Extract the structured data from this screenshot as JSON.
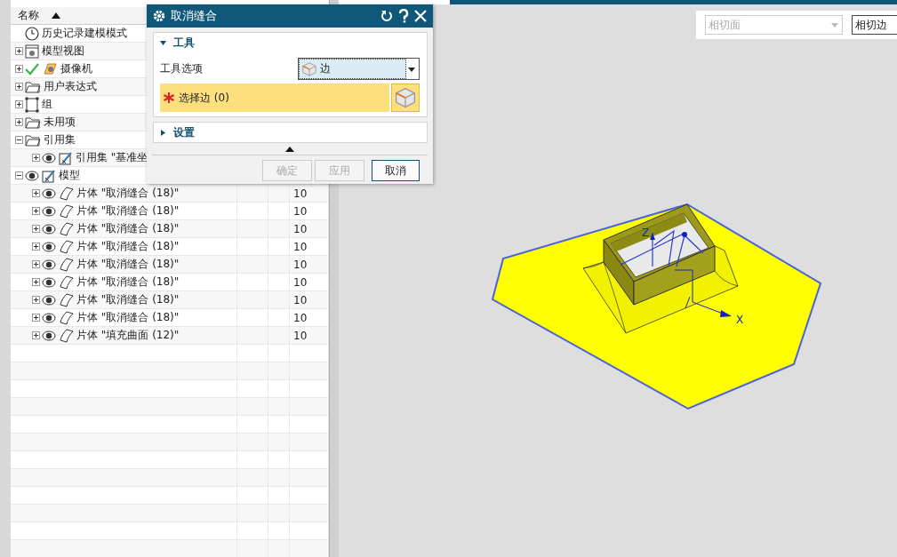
{
  "navigator": {
    "header": "名称",
    "items": [
      {
        "label": "历史记录建模模式",
        "kind": "clock"
      },
      {
        "label": "模型视图",
        "kind": "view",
        "expanded": false
      },
      {
        "label": "摄像机",
        "kind": "camera",
        "expanded": false,
        "checked": true
      },
      {
        "label": "用户表达式",
        "kind": "folder",
        "expanded": false
      },
      {
        "label": "组",
        "kind": "group",
        "expanded": false
      },
      {
        "label": "未用项",
        "kind": "folder",
        "expanded": false
      },
      {
        "label": "引用集",
        "kind": "folder",
        "expanded": true,
        "children": [
          {
            "label": "引用集 \"基准坐",
            "kind": "refset",
            "expanded": false,
            "visible": true
          }
        ]
      },
      {
        "label": "模型",
        "kind": "refset",
        "expanded": true,
        "visible": true,
        "children": [
          {
            "label": "片体 \"取消缝合 (18)\"",
            "kind": "sheet",
            "expanded": false,
            "visible": true,
            "value": "10"
          },
          {
            "label": "片体 \"取消缝合 (18)\"",
            "kind": "sheet",
            "expanded": false,
            "visible": true,
            "value": "10"
          },
          {
            "label": "片体 \"取消缝合 (18)\"",
            "kind": "sheet",
            "expanded": false,
            "visible": true,
            "value": "10"
          },
          {
            "label": "片体 \"取消缝合 (18)\"",
            "kind": "sheet",
            "expanded": false,
            "visible": true,
            "value": "10"
          },
          {
            "label": "片体 \"取消缝合 (18)\"",
            "kind": "sheet",
            "expanded": false,
            "visible": true,
            "value": "10"
          },
          {
            "label": "片体 \"取消缝合 (18)\"",
            "kind": "sheet",
            "expanded": false,
            "visible": true,
            "value": "10"
          },
          {
            "label": "片体 \"取消缝合 (18)\"",
            "kind": "sheet",
            "expanded": false,
            "visible": true,
            "value": "10"
          },
          {
            "label": "片体 \"取消缝合 (18)\"",
            "kind": "sheet",
            "expanded": false,
            "visible": true,
            "value": "10"
          },
          {
            "label": "片体 \"填充曲面 (12)\"",
            "kind": "sheet",
            "expanded": false,
            "visible": true,
            "value": "10"
          }
        ]
      }
    ]
  },
  "dialog": {
    "title": "取消缝合",
    "sections": [
      {
        "title": "工具",
        "expanded": true,
        "option_label": "工具选项",
        "option_value": "边",
        "select": {
          "label": "选择边 (0)",
          "selected": true
        }
      },
      {
        "title": "设置",
        "expanded": false
      }
    ],
    "buttons": [
      {
        "label": "确定",
        "disabled": true
      },
      {
        "label": "应用",
        "disabled": true
      },
      {
        "label": "取消",
        "disabled": false
      }
    ]
  },
  "toolbar": {
    "combos": [
      {
        "value": "相切面",
        "disabled": true
      },
      {
        "value": "相切边",
        "disabled": false
      }
    ]
  },
  "viewport": {
    "axis_labels": [
      "Z",
      "X"
    ]
  }
}
